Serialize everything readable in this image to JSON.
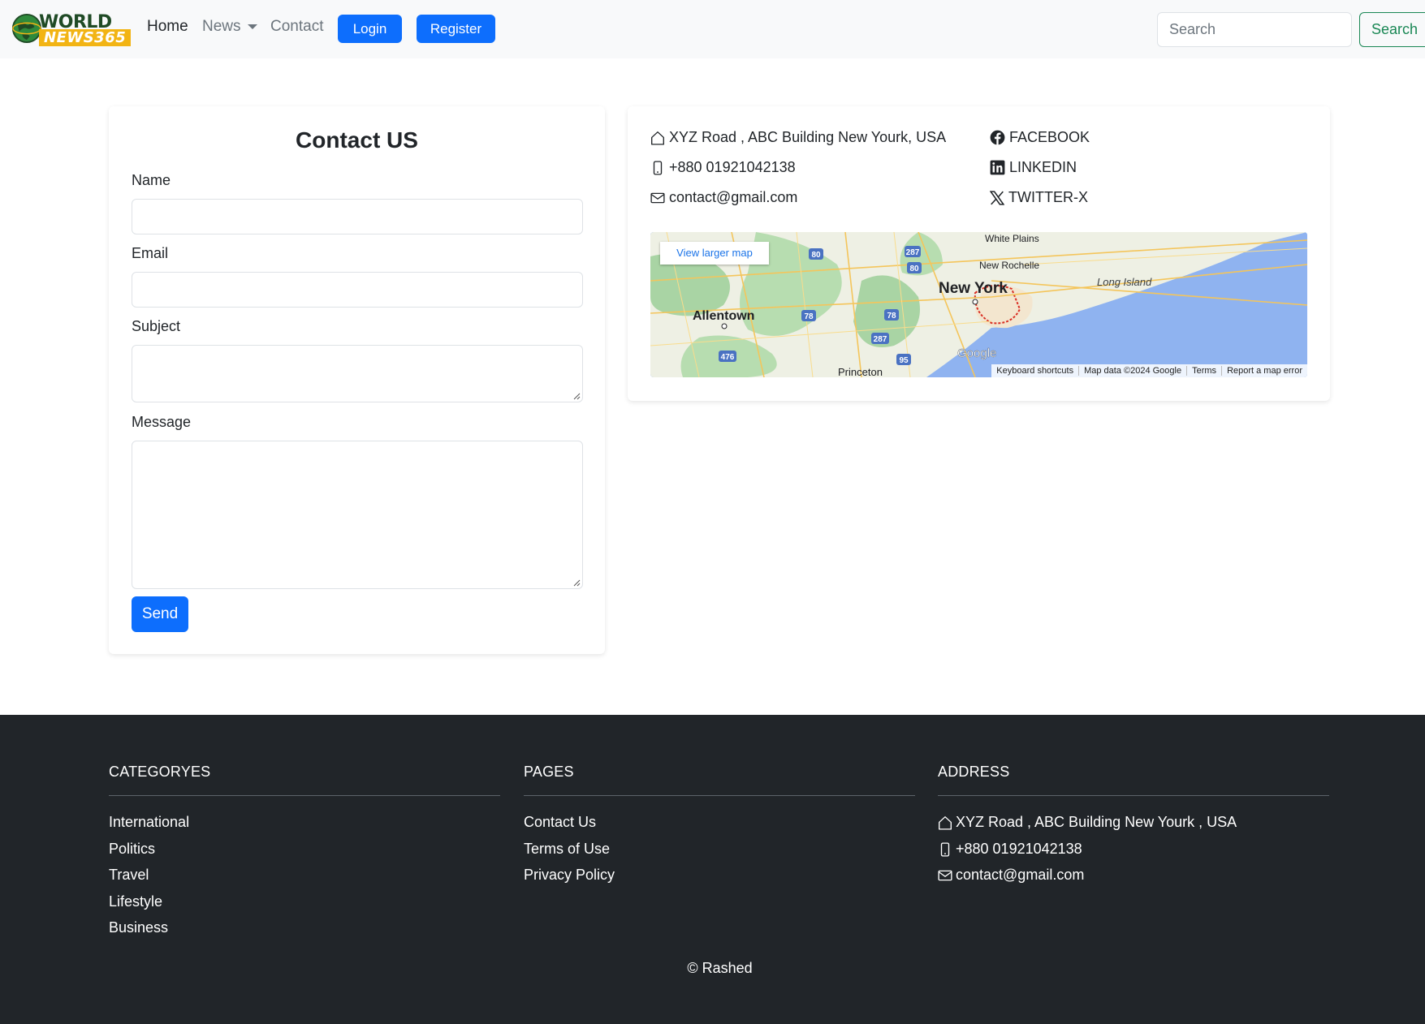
{
  "navbar": {
    "logo_line1": "WORLD",
    "logo_line2": "NEWS365",
    "links": [
      {
        "label": "Home"
      },
      {
        "label": "News"
      },
      {
        "label": "Contact"
      }
    ],
    "login_label": "Login",
    "register_label": "Register",
    "search_placeholder": "Search",
    "search_button": "Search"
  },
  "contact_form": {
    "title": "Contact US",
    "name_label": "Name",
    "email_label": "Email",
    "subject_label": "Subject",
    "message_label": "Message",
    "send_label": "Send"
  },
  "contact_info": {
    "address": "XYZ Road , ABC Building New Yourk, USA",
    "phone": "+880 01921042138",
    "email": "contact@gmail.com",
    "facebook": "FACEBOOK",
    "linkedin": "LINKEDIN",
    "twitter": "TWITTER-X"
  },
  "map": {
    "view_larger": "View larger map",
    "labels": {
      "white_plains": "White Plains",
      "new_rochelle": "New Rochelle",
      "new_york": "New York",
      "long_island": "Long Island",
      "allentown": "Allentown",
      "princeton": "Princeton",
      "google": "Google"
    },
    "highways": [
      "287",
      "80",
      "80",
      "78",
      "78",
      "287",
      "476",
      "95"
    ],
    "attribution": [
      "Keyboard shortcuts",
      "Map data ©2024 Google",
      "Terms",
      "Report a map error"
    ]
  },
  "footer": {
    "categories_title": "CATEGORYES",
    "categories": [
      "International",
      "Politics",
      "Travel",
      "Lifestyle",
      "Business"
    ],
    "pages_title": "PAGES",
    "pages": [
      "Contact Us",
      "Terms of Use",
      "Privacy Policy"
    ],
    "address_title": "ADDRESS",
    "address": "XYZ Road , ABC Building New Yourk , USA",
    "phone": "+880 01921042138",
    "email": "contact@gmail.com",
    "copyright": "© Rashed"
  },
  "colors": {
    "primary": "#0d6efd",
    "success": "#198754",
    "footer_bg": "#212529",
    "navbar_bg": "#f8f9fa"
  }
}
